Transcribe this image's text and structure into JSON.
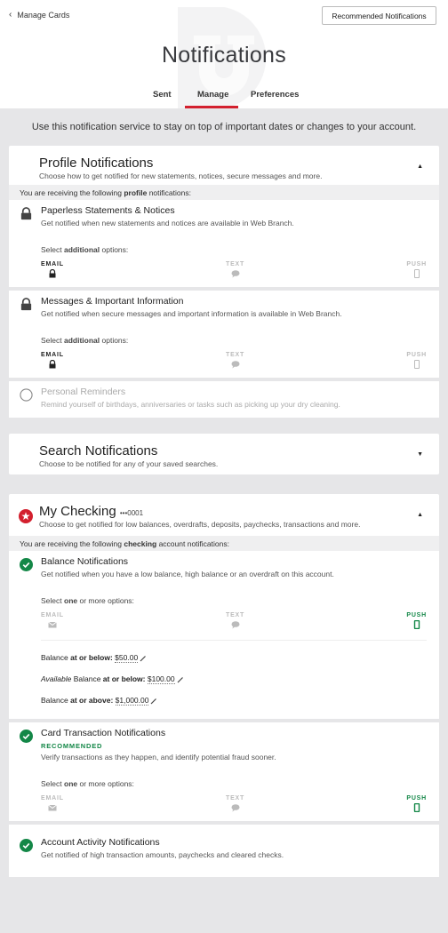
{
  "header": {
    "back_label": "Manage Cards",
    "recommended_button": "Recommended Notifications",
    "title": "Notifications",
    "tabs": [
      {
        "label": "Sent",
        "active": false
      },
      {
        "label": "Manage",
        "active": true
      },
      {
        "label": "Preferences",
        "active": false
      }
    ]
  },
  "intro": "Use this notification service to stay on top of important dates or changes to your account.",
  "colors": {
    "accent_red": "#d3202e",
    "success_green": "#138747",
    "bg_gray": "#e6e6e8"
  },
  "profile": {
    "title": "Profile Notifications",
    "subtitle": "Choose how to get notified for new statements, notices, secure messages and more.",
    "expanded": true,
    "receiving_pre": "You are receiving the following ",
    "receiving_bold": "profile",
    "receiving_post": " notifications:",
    "items": [
      {
        "title": "Paperless Statements & Notices",
        "desc": "Get notified when new statements and notices are available in Web Branch.",
        "status_icon": "lock-icon",
        "select_pre": "Select ",
        "select_bold": "additional",
        "select_post": " options:",
        "channels": {
          "email": "EMAIL",
          "text": "TEXT",
          "push": "PUSH"
        }
      },
      {
        "title": "Messages & Important Information",
        "desc": "Get notified when secure messages and important information is available in Web Branch.",
        "status_icon": "lock-icon",
        "select_pre": "Select ",
        "select_bold": "additional",
        "select_post": " options:",
        "channels": {
          "email": "EMAIL",
          "text": "TEXT",
          "push": "PUSH"
        }
      },
      {
        "title": "Personal Reminders",
        "desc": "Remind yourself of birthdays, anniversaries or tasks such as picking up your dry cleaning.",
        "status_icon": "empty-circle-icon",
        "enabled": false
      }
    ]
  },
  "search": {
    "title": "Search Notifications",
    "subtitle": "Choose to be notified for any of your saved searches.",
    "expanded": false
  },
  "checking": {
    "title": "My Checking",
    "account_mask": "•••0001",
    "subtitle": "Choose to get notified for low balances, overdrafts, deposits, paychecks, transactions and more.",
    "expanded": true,
    "receiving_pre": "You are receiving the following ",
    "receiving_bold": "checking",
    "receiving_post": " account notifications:",
    "items": [
      {
        "title": "Balance Notifications",
        "desc": "Get notified when you have a low balance, high balance or an overdraft on this account.",
        "select_pre": "Select ",
        "select_bold": "one",
        "select_post": " or more options:",
        "channels": {
          "email": "EMAIL",
          "text": "TEXT",
          "push": "PUSH"
        },
        "selected_channel": "PUSH",
        "thresholds": [
          {
            "prefix_italic": "",
            "prefix": "Balance ",
            "bold": "at or below:",
            "amount": "$50.00"
          },
          {
            "prefix_italic": "Available",
            "prefix": " Balance ",
            "bold": "at or below:",
            "amount": "$100.00"
          },
          {
            "prefix_italic": "",
            "prefix": "Balance ",
            "bold": "at or above:",
            "amount": "$1,000.00"
          }
        ]
      },
      {
        "title": "Card Transaction Notifications",
        "badge": "RECOMMENDED",
        "desc": "Verify transactions as they happen, and identify potential fraud sooner.",
        "select_pre": "Select ",
        "select_bold": "one",
        "select_post": " or more options:",
        "channels": {
          "email": "EMAIL",
          "text": "TEXT",
          "push": "PUSH"
        },
        "selected_channel": "PUSH"
      },
      {
        "title": "Account Activity Notifications",
        "desc": "Get notified of high transaction amounts, paychecks and cleared checks."
      }
    ]
  }
}
